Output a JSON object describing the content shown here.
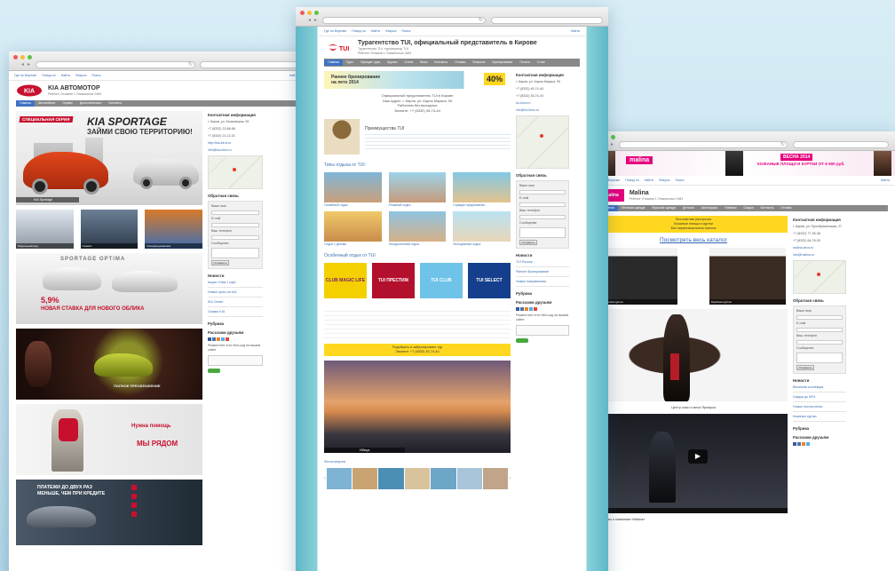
{
  "kia": {
    "toplinks": [
      "Где по Березке",
      "Повод по",
      "Найти",
      "Фикусы",
      "Поиск"
    ],
    "toplinks_right": "Найти",
    "title": "KIA АВТОМОТОР",
    "meta": "Рейтинг   Отзывов 1   Уникальные 2484",
    "menu": [
      "Главная",
      "Автомобили",
      "Сервис",
      "Дополнительно",
      "Контакты"
    ],
    "hero": {
      "tag": "СПЕЦИАЛЬНАЯ СЕРИЯ",
      "brand": "KIA SPORTAGE",
      "slogan": "ЗАЙМИ СВОЮ ТЕРРИТОРИЮ!",
      "caption": "KIA Sportage"
    },
    "thumbs": [
      "Модельный ряд",
      "Сервис",
      "Спецпредложения"
    ],
    "b2": {
      "models": "SPORTAGE      OPTIMA",
      "rate": "5,9%",
      "text": "НОВАЯ СТАВКА ДЛЯ НОВОГО ОБЛИКА"
    },
    "b3": {
      "text": "ПОЛНОЕ ПРЕОБРАЖЕНИЕ"
    },
    "b4": {
      "line1": "Нужна помощь",
      "line2": "МЫ РЯДОМ"
    },
    "b5": {
      "line1": "ПЛАТЕЖИ ДО ДВУХ РАЗ",
      "line2": "МЕНЬШЕ, ЧЕМ ПРИ КРЕДИТЕ"
    },
    "side": {
      "contact_title": "Контактная информация",
      "contacts": [
        "г. Киров, ул. Московская, 55",
        "+7 (8332) 22-86-86",
        "+7 (8332) 21-12-31",
        "http://kia-kirov.ru",
        "info@kia-kirov.ru"
      ],
      "feedback_title": "Обратная связь",
      "form_labels": [
        "Ваше имя",
        "E-mail",
        "Ваш телефон",
        "Сообщение"
      ],
      "submit": "Отправить",
      "news_title": "Новости",
      "news": [
        "Акция «Нам 1 год!»",
        "Новые цены на KIA",
        "KIA Cerato",
        "Сервис KIA"
      ],
      "rubric_title": "Рубрика",
      "share_title": "Расскажи друзьям",
      "code_title": "Разместите этот html-код на вашем сайте"
    },
    "colors": {
      "menu_active": "#3f73c2",
      "logo_red": "#c8102e"
    }
  },
  "tui": {
    "toplinks": [
      "Где по Березке",
      "Повод по",
      "Найти",
      "Фикусы",
      "Поиск"
    ],
    "toplinks_right": "Найти",
    "title": "Турагентство TUI, официальный представитель в Кирове",
    "subtitle": "Турагентство TUI, туроператор TUI",
    "meta": "Рейтинг   Отзывов 1   Уникальные 2484",
    "logo": "TUI",
    "menu": [
      "Главная",
      "Туры",
      "Горящие туры",
      "Круизы",
      "Отели",
      "Визы",
      "Контакты",
      "Отзывы",
      "Вопросы",
      "Бронирование",
      "Оплата",
      "О нас"
    ],
    "promo": {
      "text": "Раннее бронирование на лето 2014",
      "badge": "40%"
    },
    "info_lines": [
      "Официальный представитель TUI в Кирове",
      "Наш адрес: г. Киров, ул. Карла Маркса, 90",
      "Работаем без выходных",
      "Звоните: +7 (8332) 45-74-44"
    ],
    "adv_title": "Преимущества TUI",
    "types_title": "Типы отдыха от TUI:",
    "types": [
      "Семейный отдых",
      "Пляжный отдых",
      "Горящие предложения",
      "Отдых с детьми",
      "Экскурсионный отдых",
      "Молодежный отдых"
    ],
    "special_title": "Особенный отдых от TUI",
    "special": [
      "CLUB MAGIC LIFE",
      "TUI ПРЕСТИЖ",
      "TUI CLUB",
      "TUI SELECT"
    ],
    "yellow_lines": [
      "Подобрать и забронировать тур",
      "Звоните: +7 (8332) 45-74-44"
    ],
    "beach_caption": "Ибица",
    "gallery_title": "Фотогалерея",
    "side": {
      "contact_title": "Контактная информация",
      "contacts": [
        "г. Киров, ул. Карла Маркса, 90",
        "+7 (8332) 45-74-44",
        "+7 (8332) 35-74-44",
        "tui-kirov.ru",
        "info@tui-kirov.ru"
      ],
      "feedback_title": "Обратная связь",
      "form_labels": [
        "Ваше имя",
        "E-mail",
        "Ваш телефон",
        "Сообщение"
      ],
      "submit": "Отправить",
      "news_title": "Новости",
      "news": [
        "TUI Россия",
        "Раннее бронирование",
        "Новые направления"
      ],
      "rubric_title": "Рубрика",
      "share_title": "Расскажи друзьям",
      "code_title": "Разместите этот html-код на вашем сайте"
    },
    "colors": {
      "menu_active": "#3f73c2",
      "logo_red": "#e2001a",
      "promo": "#ffd71f"
    }
  },
  "malina": {
    "toplinks": [
      "Где по Березке",
      "Повод по",
      "Найти",
      "Фикусы",
      "Поиск"
    ],
    "toplinks_right": "Найти",
    "banner": {
      "brand": "malina",
      "season": "ВЕСНА 2014",
      "offer": "КОЖАНЫЕ ПЛАЩИ И КУРТКИ ОТ 6 500 руб."
    },
    "title": "Malina",
    "meta": "Рейтинг   Отзывов 1   Уникальные 2484",
    "menu": [
      "Главная",
      "Женская одежда",
      "Мужская одежда",
      "Детская",
      "Аксессуары",
      "Новинки",
      "Скидки",
      "Контакты",
      "Отзывы"
    ],
    "notice": [
      "Бесплатная рассрочка",
      "Кожаные плащи и куртки",
      "Без первоначального взноса"
    ],
    "catalog_link": "Посмотреть весь каталог",
    "photos": [
      "Женская куртка",
      "Мужская куртка"
    ],
    "center_caption": "Центр кожи и меха Ярмарка",
    "video_caption": "Отзывы о компании «Malina»",
    "side": {
      "contact_title": "Контактная информация",
      "contacts": [
        "г. Киров, ул. Преображенская, 27",
        "+7 (8332) 77-36-36",
        "+7 (8332) 64-76-00",
        "malina-kirov.ru",
        "info@malina.ru"
      ],
      "feedback_title": "Обратная связь",
      "form_labels": [
        "Ваше имя",
        "E-mail",
        "Ваш телефон",
        "Сообщение"
      ],
      "submit": "Отправить",
      "news_title": "Новости",
      "news": [
        "Весенняя коллекция",
        "Скидки до 50%",
        "Новые поступления",
        "Кожаные куртки"
      ],
      "rubric_title": "Рубрика",
      "share_title": "Расскажи друзьям"
    },
    "colors": {
      "brand_pink": "#e6007e",
      "menu_active": "#3f73c2",
      "notice": "#ffd71f"
    }
  }
}
